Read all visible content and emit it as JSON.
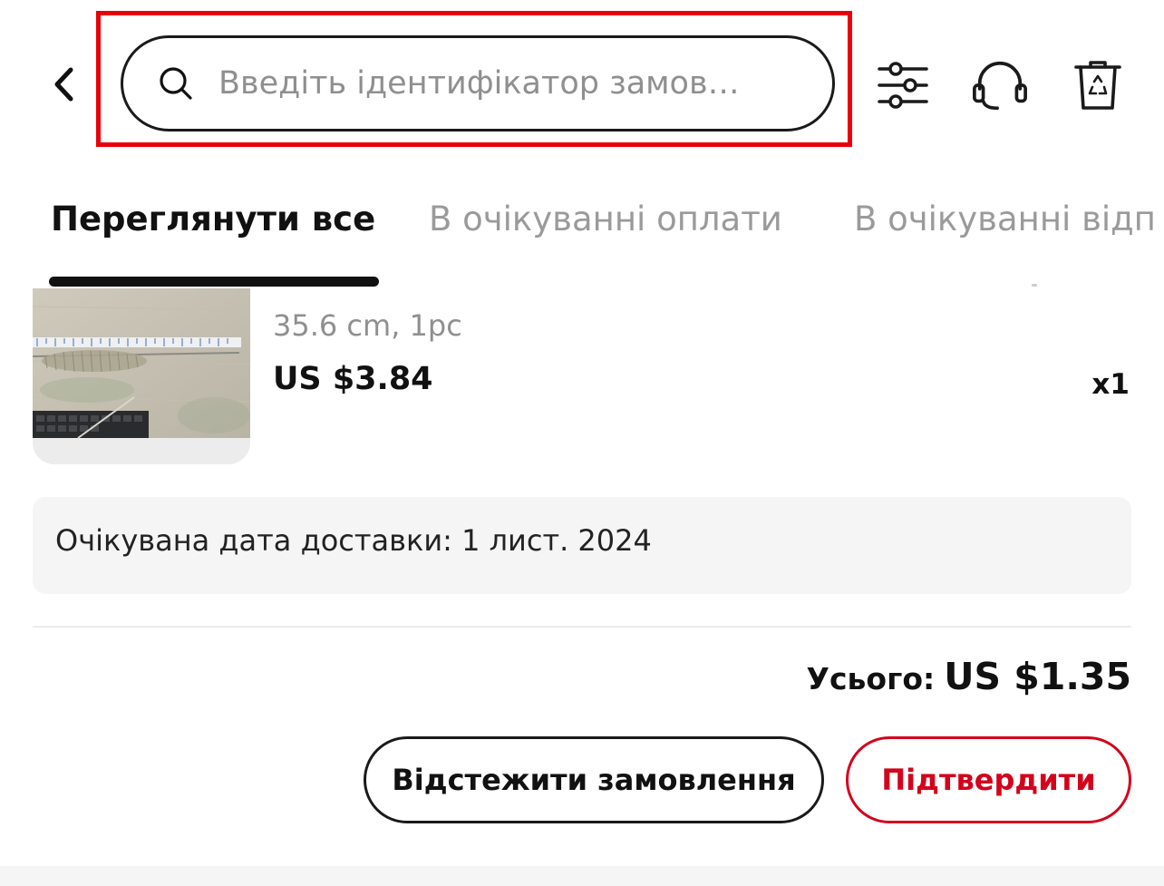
{
  "header": {
    "search_placeholder": "Введіть ідентифікатор замов…",
    "icons": [
      "back-icon",
      "search-icon",
      "filter-sliders-icon",
      "headset-support-icon",
      "recycle-bin-icon"
    ]
  },
  "tabs": [
    {
      "label": "Переглянути все",
      "active": true
    },
    {
      "label": "В очікуванні оплати",
      "active": false
    },
    {
      "label": "В очікуванні відп",
      "active": false
    }
  ],
  "product": {
    "variant": "35.6 cm, 1pc",
    "price": "US $3.84",
    "quantity": "x1"
  },
  "delivery": {
    "text": "Очікувана дата доставки: 1 лист. 2024"
  },
  "total": {
    "label": "Усього:",
    "value": "US $1.35"
  },
  "buttons": {
    "track": "Відстежити замовлення",
    "confirm": "Підтвердити"
  },
  "colors": {
    "accent": "#d3031c",
    "highlight": "#e8000b",
    "muted_text": "#8f8f8f",
    "panel_bg": "#f5f5f5"
  }
}
